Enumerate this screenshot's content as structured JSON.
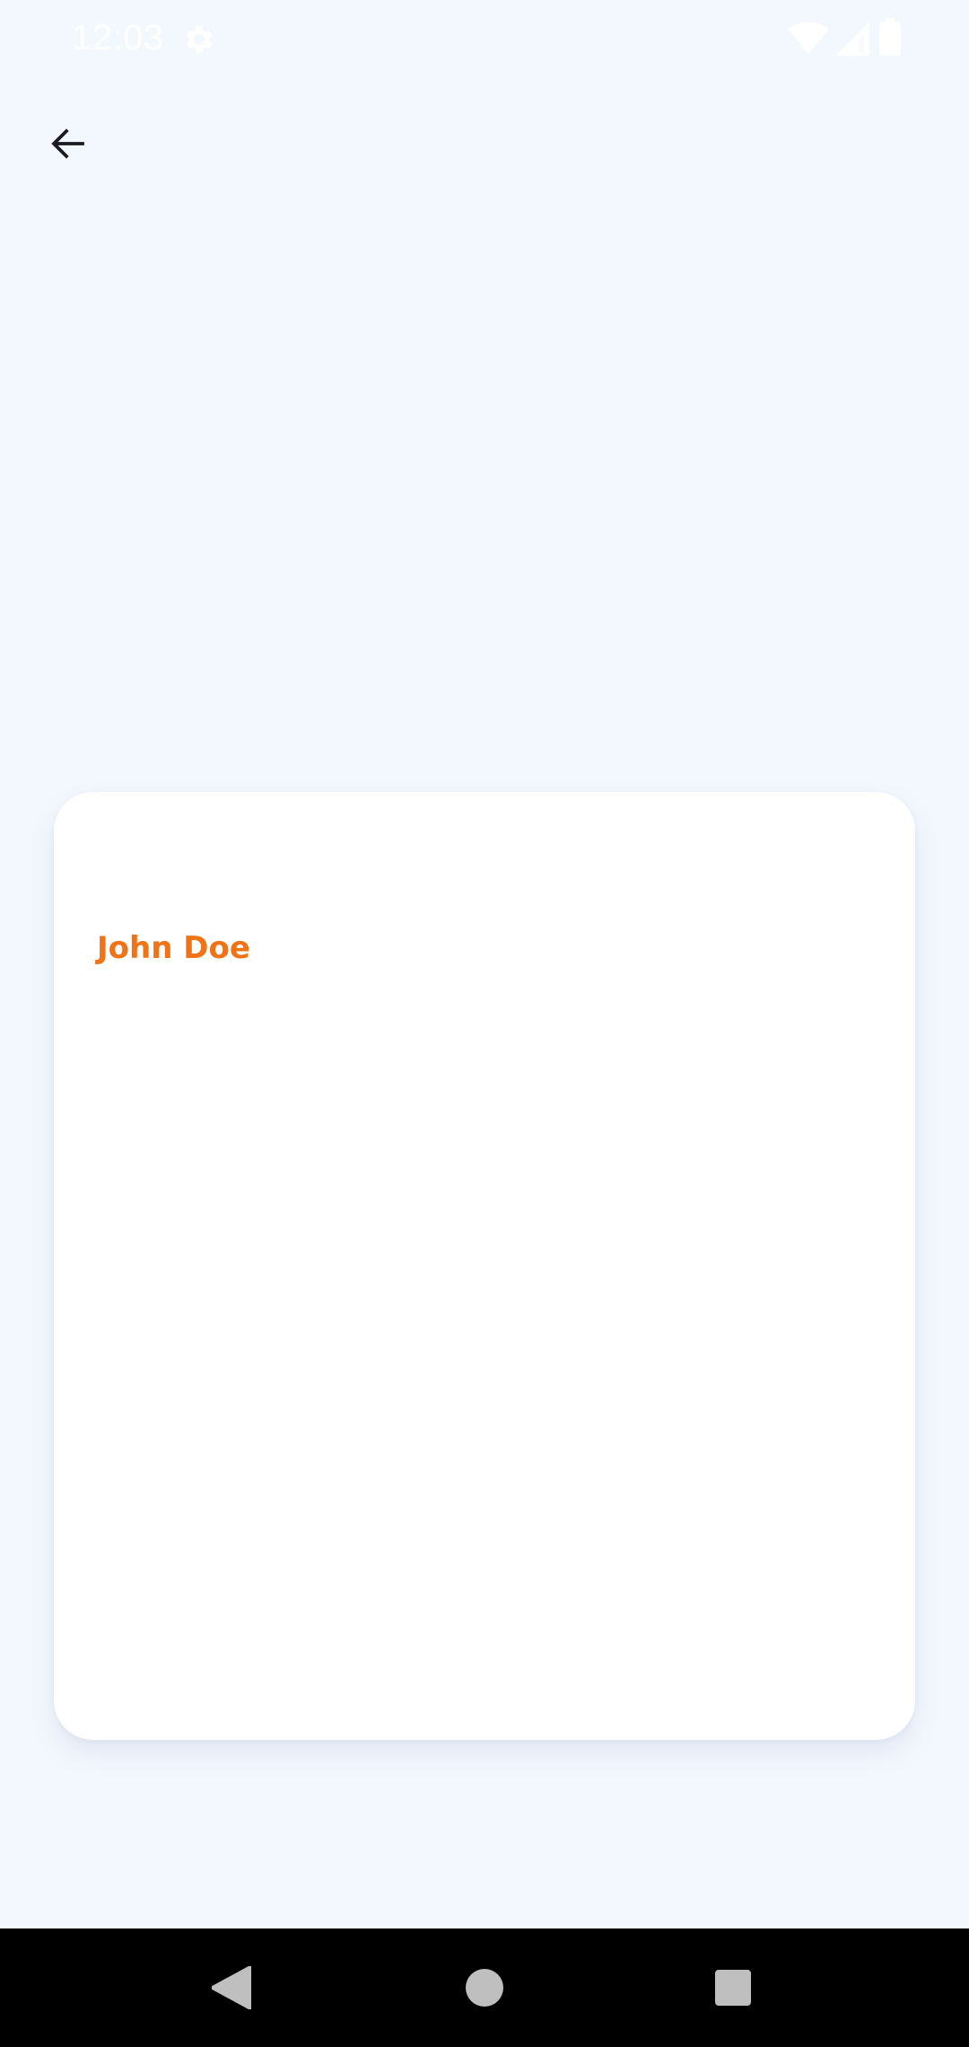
{
  "status_bar": {
    "time": "12:03",
    "icons": [
      "settings-icon",
      "wifi-icon",
      "signal-icon",
      "battery-icon"
    ]
  },
  "app_bar": {
    "back_icon": "arrow-left-icon"
  },
  "card": {
    "name": "John Doe",
    "name_color": "#f07318"
  },
  "nav_bar": {
    "buttons": [
      "back",
      "home",
      "recents"
    ]
  },
  "colors": {
    "background": "#f3f7fe",
    "card": "#ffffff",
    "accent": "#f07318"
  }
}
